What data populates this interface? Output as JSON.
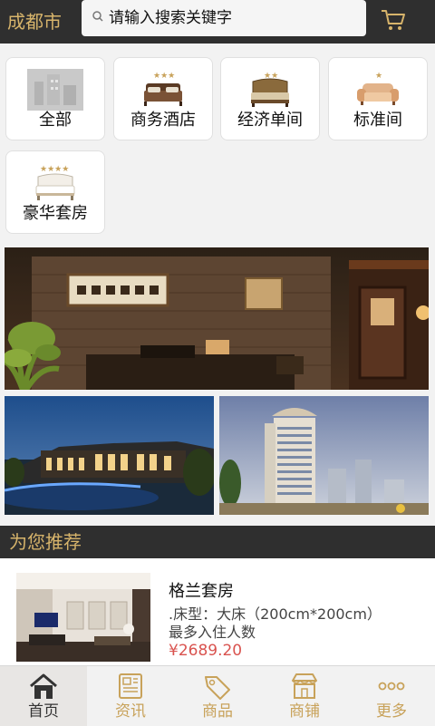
{
  "header": {
    "city": "成都市",
    "search_placeholder": "请输入搜索关键字",
    "cart_icon": "cart-icon"
  },
  "categories": [
    {
      "label": "全部",
      "icon": "all-hotels-icon"
    },
    {
      "label": "商务酒店",
      "icon": "business-hotel-bed-icon",
      "stars": 3
    },
    {
      "label": "经济单间",
      "icon": "economy-room-bed-icon",
      "stars": 2
    },
    {
      "label": "标准间",
      "icon": "standard-room-sofa-icon",
      "stars": 1
    },
    {
      "label": "豪华套房",
      "icon": "luxury-suite-bed-icon",
      "stars": 4
    }
  ],
  "recommend": {
    "title": "为您推荐",
    "product": {
      "name": "格兰套房",
      "bed": ".床型：大床（200cm*200cm）",
      "capacity": "最多入住人数",
      "price": "¥2689.20"
    }
  },
  "bottom_nav": [
    {
      "label": "首页",
      "icon": "home-icon",
      "active": true
    },
    {
      "label": "资讯",
      "icon": "news-icon"
    },
    {
      "label": "商品",
      "icon": "tag-icon"
    },
    {
      "label": "商铺",
      "icon": "shop-icon"
    },
    {
      "label": "更多",
      "icon": "more-icon"
    }
  ],
  "colors": {
    "header_bg": "#2f2f2f",
    "accent_gold": "#d7b46b",
    "price_red": "#d9534f",
    "page_bg": "#f2f2f2"
  }
}
